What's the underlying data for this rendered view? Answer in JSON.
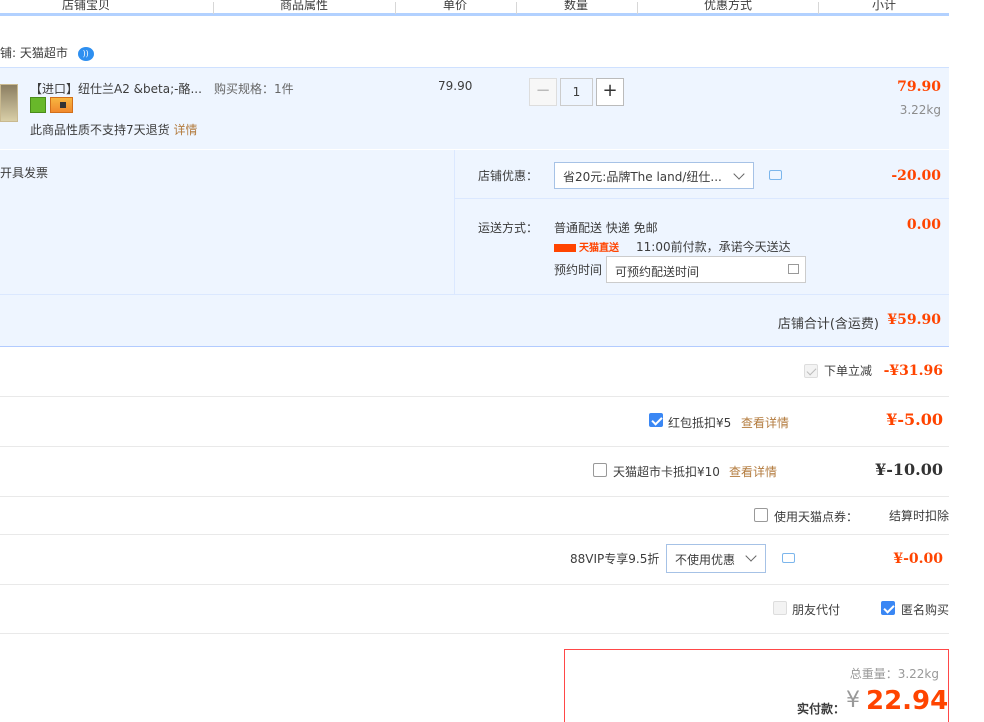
{
  "header": {
    "columns": [
      "店铺宝贝",
      "商品属性",
      "单价",
      "数量",
      "优惠方式",
      "小计"
    ]
  },
  "shop": {
    "label": "铺: 天猫超市"
  },
  "item": {
    "title": "【进口】纽仕兰A2 &beta;-酪...",
    "spec": "购买规格：1件",
    "price": "79.90",
    "quantity": "1",
    "minus": "−",
    "plus": "+",
    "subtotal": "79.90",
    "weight": "3.22kg",
    "no_return": "此商品性质不支持7天退货",
    "detail_link": "详情"
  },
  "promo": {
    "invoice": "开具发票",
    "shop_discount_label": "店铺优惠：",
    "shop_discount_value": "省20元:品牌The land/纽仕...",
    "shop_discount_amount": "-20.00",
    "shipping_label": "运送方式：",
    "shipping_method": "普通配送 快递 免邮",
    "tmall_direct": "天猫直送",
    "shipping_promise": "11:00前付款，承诺今天送达",
    "appointment_label": "预约时间",
    "appointment_value": "可预约配送时间",
    "shipping_amount": "0.00",
    "shop_total_label": "店铺合计(含运费)",
    "shop_total_amount": "¥59.90"
  },
  "discounts": {
    "instant_label": "下单立减",
    "instant_amount": "-¥31.96",
    "redpacket_label": "红包抵扣¥5",
    "redpacket_link": "查看详情",
    "redpacket_amount": "¥-5.00",
    "card_label": "天猫超市卡抵扣¥10",
    "card_link": "查看详情",
    "card_amount": "¥-10.00",
    "points_label": "使用天猫点券：",
    "points_note": "结算时扣除",
    "vip_label": "88VIP专享9.5折",
    "vip_select": "不使用优惠",
    "vip_amount": "¥-0.00",
    "friend_pay": "朋友代付",
    "anonymous": "匿名购买"
  },
  "total": {
    "weight": "总重量：3.22kg",
    "pay_label": "实付款：",
    "currency": "¥",
    "amount": "22.94"
  }
}
